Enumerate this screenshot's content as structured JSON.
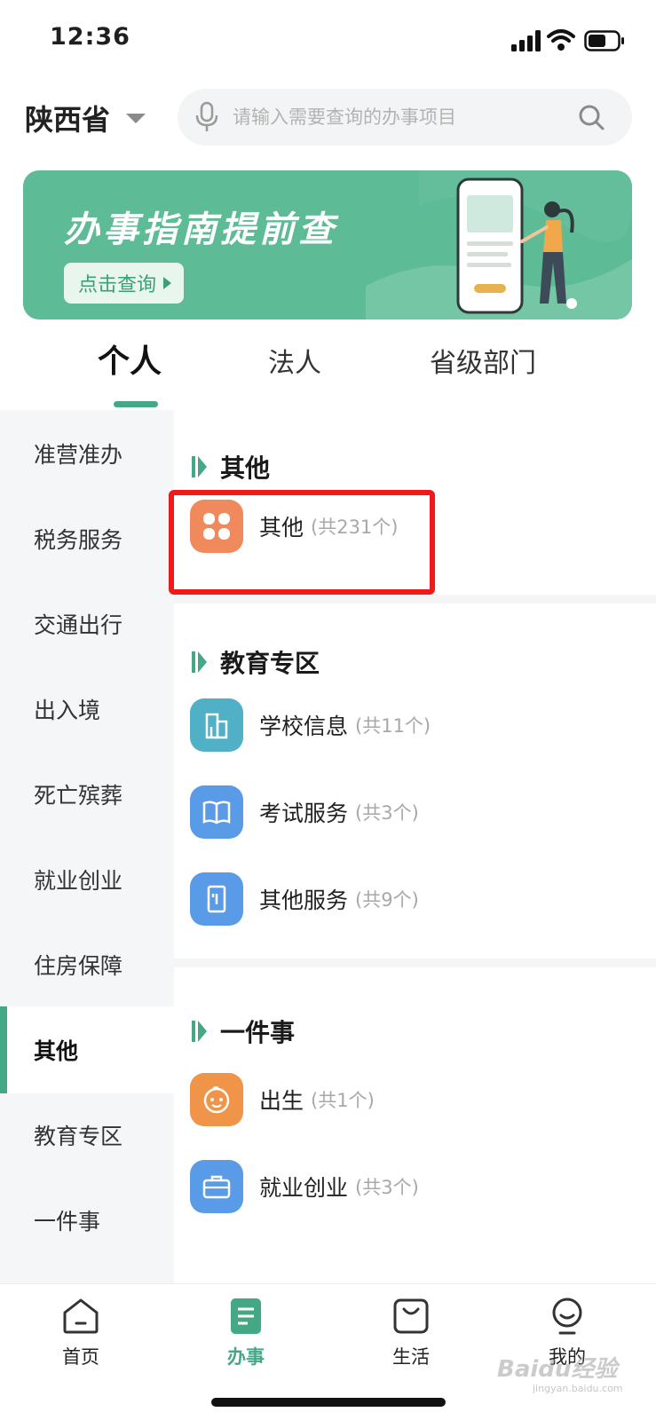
{
  "status_bar": {
    "time": "12:36"
  },
  "header": {
    "province": "陕西省",
    "search_placeholder": "请输入需要查询的办事项目"
  },
  "banner": {
    "title": "办事指南提前查",
    "button_label": "点击查询"
  },
  "tabs": [
    {
      "label": "个人",
      "active": true
    },
    {
      "label": "法人",
      "active": false
    },
    {
      "label": "省级部门",
      "active": false
    }
  ],
  "side_nav": {
    "items": [
      {
        "label": "准营准办"
      },
      {
        "label": "税务服务"
      },
      {
        "label": "交通出行"
      },
      {
        "label": "出入境"
      },
      {
        "label": "死亡殡葬"
      },
      {
        "label": "就业创业"
      },
      {
        "label": "住房保障"
      },
      {
        "label": "其他",
        "active": true
      },
      {
        "label": "教育专区"
      },
      {
        "label": "一件事"
      }
    ]
  },
  "sections": [
    {
      "title": "其他",
      "items": [
        {
          "label": "其他",
          "count": "(共231个)",
          "icon": "clover-icon",
          "color": "#f08a5d"
        }
      ]
    },
    {
      "title": "教育专区",
      "items": [
        {
          "label": "学校信息",
          "count": "(共11个)",
          "icon": "building-icon",
          "color": "#4fb0c6"
        },
        {
          "label": "考试服务",
          "count": "(共3个)",
          "icon": "book-icon",
          "color": "#5a9be8"
        },
        {
          "label": "其他服务",
          "count": "(共9个)",
          "icon": "door-icon",
          "color": "#5a9be8"
        }
      ]
    },
    {
      "title": "一件事",
      "items": [
        {
          "label": "出生",
          "count": "(共1个)",
          "icon": "baby-face-icon",
          "color": "#f0944a"
        },
        {
          "label": "就业创业",
          "count": "(共3个)",
          "icon": "briefcase-icon",
          "color": "#5a9be8"
        }
      ]
    }
  ],
  "bottom_bar": [
    {
      "label": "首页",
      "icon": "home-icon"
    },
    {
      "label": "办事",
      "icon": "document-icon",
      "active": true
    },
    {
      "label": "生活",
      "icon": "shopping-bag-icon"
    },
    {
      "label": "我的",
      "icon": "profile-icon"
    }
  ],
  "watermark": {
    "text": "Baidu经验",
    "sub": "jingyan.baidu.com"
  },
  "colors": {
    "accent": "#44a884",
    "banner": "#5dbb96",
    "highlight": "#f01818"
  }
}
